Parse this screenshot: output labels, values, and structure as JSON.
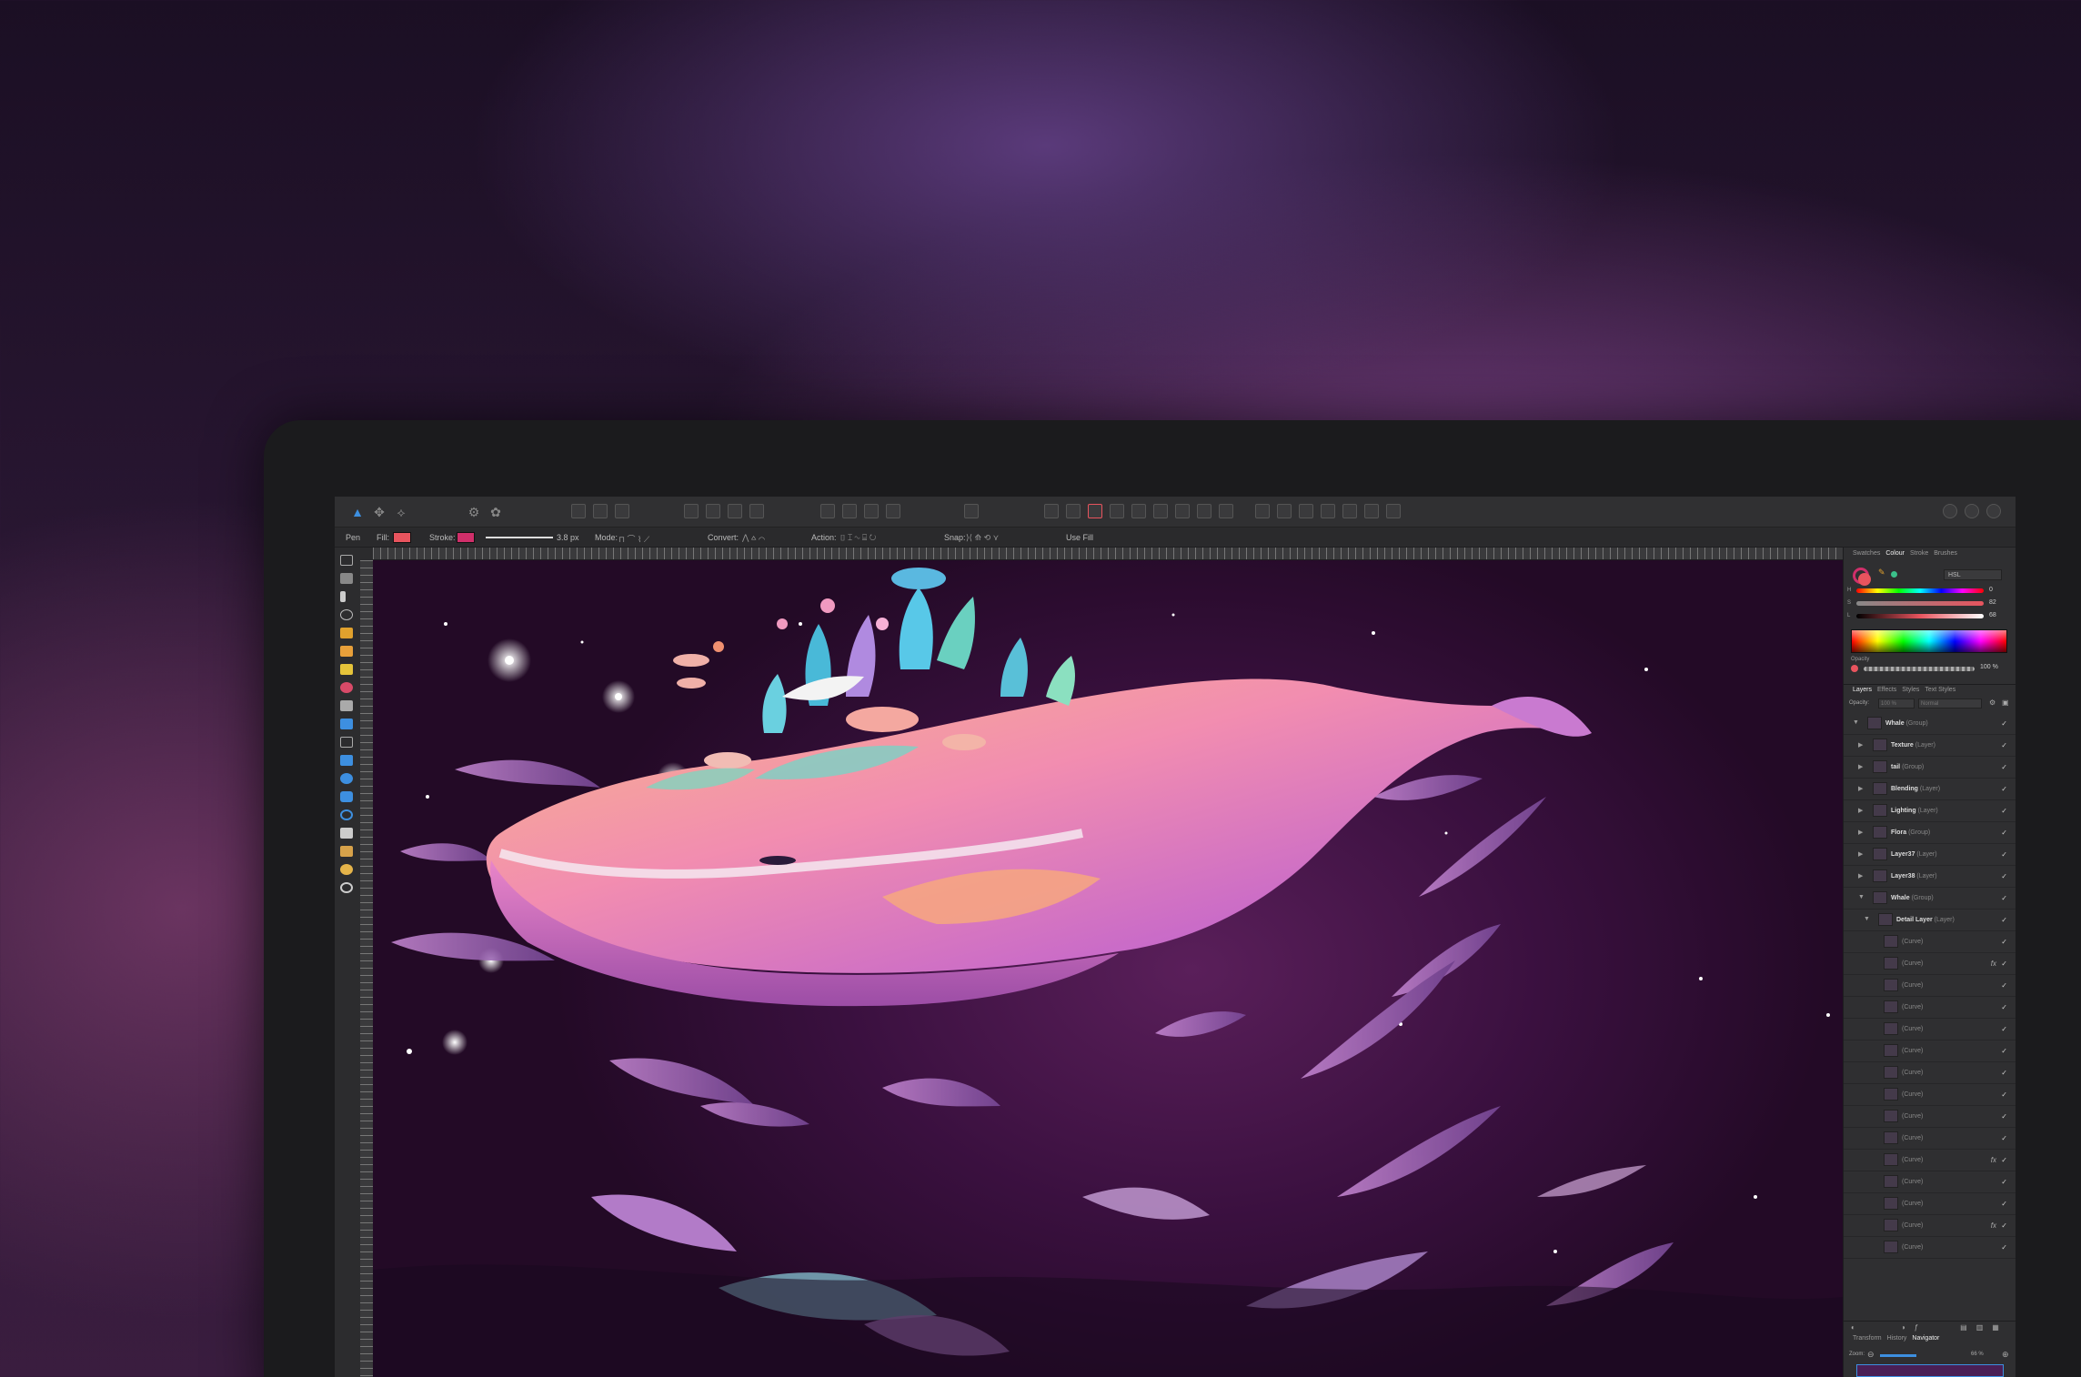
{
  "colors": {
    "fill": "#e8545e",
    "stroke": "#d02f6a",
    "accent": "#3d8fe0"
  },
  "context": {
    "tool": "Pen",
    "fill_label": "Fill:",
    "stroke_label": "Stroke:",
    "stroke_width": "3.8 px",
    "mode_label": "Mode:",
    "convert_label": "Convert:",
    "action_label": "Action:",
    "snap_label": "Snap:",
    "use_fill": "Use Fill"
  },
  "colour_panel": {
    "tabs": [
      "Swatches",
      "Colour",
      "Stroke",
      "Brushes"
    ],
    "active_tab": "Colour",
    "model": "HSL",
    "h_label": "H",
    "h_value": "0",
    "s_label": "S",
    "s_value": "82",
    "l_label": "L",
    "l_value": "68",
    "opacity_label": "Opacity",
    "opacity_value": "100 %"
  },
  "layers_panel": {
    "tabs": [
      "Layers",
      "Effects",
      "Styles",
      "Text Styles"
    ],
    "active_tab": "Layers",
    "opacity_label": "Opacity:",
    "opacity_value": "100 %",
    "blend_value": "Normal",
    "rows": [
      {
        "name": "Whale",
        "kind": "(Group)",
        "indent": 0,
        "fx": false
      },
      {
        "name": "Texture",
        "kind": "(Layer)",
        "indent": 1,
        "fx": false
      },
      {
        "name": "tail",
        "kind": "(Group)",
        "indent": 1,
        "fx": false
      },
      {
        "name": "Blending",
        "kind": "(Layer)",
        "indent": 1,
        "fx": false
      },
      {
        "name": "Lighting",
        "kind": "(Layer)",
        "indent": 1,
        "fx": false
      },
      {
        "name": "Flora",
        "kind": "(Group)",
        "indent": 1,
        "fx": false
      },
      {
        "name": "Layer37",
        "kind": "(Layer)",
        "indent": 1,
        "fx": false
      },
      {
        "name": "Layer38",
        "kind": "(Layer)",
        "indent": 1,
        "fx": false
      },
      {
        "name": "Whale",
        "kind": "(Group)",
        "indent": 1,
        "fx": false
      },
      {
        "name": "Detail Layer",
        "kind": "(Layer)",
        "indent": 2,
        "fx": false
      },
      {
        "name": "",
        "kind": "(Curve)",
        "indent": 3,
        "fx": false
      },
      {
        "name": "",
        "kind": "(Curve)",
        "indent": 3,
        "fx": true
      },
      {
        "name": "",
        "kind": "(Curve)",
        "indent": 3,
        "fx": false
      },
      {
        "name": "",
        "kind": "(Curve)",
        "indent": 3,
        "fx": false
      },
      {
        "name": "",
        "kind": "(Curve)",
        "indent": 3,
        "fx": false
      },
      {
        "name": "",
        "kind": "(Curve)",
        "indent": 3,
        "fx": false
      },
      {
        "name": "",
        "kind": "(Curve)",
        "indent": 3,
        "fx": false
      },
      {
        "name": "",
        "kind": "(Curve)",
        "indent": 3,
        "fx": false
      },
      {
        "name": "",
        "kind": "(Curve)",
        "indent": 3,
        "fx": false
      },
      {
        "name": "",
        "kind": "(Curve)",
        "indent": 3,
        "fx": false
      },
      {
        "name": "",
        "kind": "(Curve)",
        "indent": 3,
        "fx": true
      },
      {
        "name": "",
        "kind": "(Curve)",
        "indent": 3,
        "fx": false
      },
      {
        "name": "",
        "kind": "(Curve)",
        "indent": 3,
        "fx": false
      },
      {
        "name": "",
        "kind": "(Curve)",
        "indent": 3,
        "fx": true
      },
      {
        "name": "",
        "kind": "(Curve)",
        "indent": 3,
        "fx": false
      }
    ]
  },
  "bottom_panel": {
    "tabs": [
      "Transform",
      "History",
      "Navigator"
    ],
    "active_tab": "Navigator",
    "zoom_label": "Zoom:",
    "zoom_value": "66 %"
  }
}
